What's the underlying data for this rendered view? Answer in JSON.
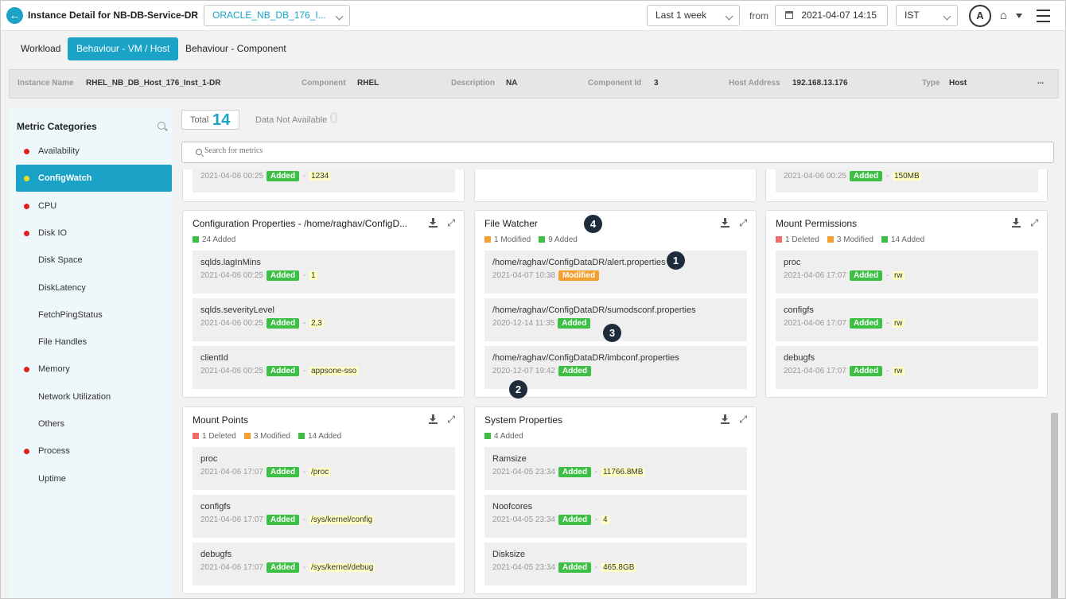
{
  "header": {
    "title": "Instance Detail for NB-DB-Service-DR",
    "instance_select": "ORACLE_NB_DB_176_I...",
    "range_select": "Last 1 week",
    "from_label": "from",
    "from_date": "2021-04-07 14:15",
    "tz_select": "IST",
    "avatar": "A"
  },
  "tabs": [
    "Workload",
    "Behaviour - VM / Host",
    "Behaviour - Component"
  ],
  "info": {
    "instance_name_label": "Instance Name",
    "instance_name": "RHEL_NB_DB_Host_176_Inst_1-DR",
    "component_label": "Component",
    "component": "RHEL",
    "description_label": "Description",
    "description": "NA",
    "component_id_label": "Component Id",
    "component_id": "3",
    "host_address_label": "Host Address",
    "host_address": "192.168.13.176",
    "type_label": "Type",
    "type": "Host",
    "more": "..."
  },
  "sidebar": {
    "title": "Metric Categories",
    "items": [
      {
        "label": "Availability",
        "status": "red"
      },
      {
        "label": "ConfigWatch",
        "status": "yellow",
        "active": true
      },
      {
        "label": "CPU",
        "status": "red"
      },
      {
        "label": "Disk IO",
        "status": "red"
      },
      {
        "label": "Disk Space",
        "status": "none"
      },
      {
        "label": "DiskLatency",
        "status": "none"
      },
      {
        "label": "FetchPingStatus",
        "status": "none"
      },
      {
        "label": "File Handles",
        "status": "none"
      },
      {
        "label": "Memory",
        "status": "red"
      },
      {
        "label": "Network Utilization",
        "status": "none"
      },
      {
        "label": "Others",
        "status": "none"
      },
      {
        "label": "Process",
        "status": "red"
      },
      {
        "label": "Uptime",
        "status": "none"
      }
    ]
  },
  "totals": {
    "total_label": "Total",
    "total": "14",
    "na_label": "Data Not Available",
    "na": "0"
  },
  "search": {
    "placeholder": "Search for metrics"
  },
  "partial_rows": [
    {
      "date": "2021-04-06 00:25",
      "badge": "Added",
      "value": "1234"
    },
    {
      "date": "2021-04-06 00:25",
      "badge": "Added",
      "value": "150MB"
    }
  ],
  "cards": [
    {
      "title": "Configuration Properties - /home/raghav/ConfigD...",
      "stats": [
        {
          "color": "g",
          "text": "24 Added"
        }
      ],
      "rows": [
        {
          "name": "sqlds.lagInMins",
          "date": "2021-04-06 00:25",
          "badge": "Added",
          "value": "1"
        },
        {
          "name": "sqlds.severityLevel",
          "date": "2021-04-06 00:25",
          "badge": "Added",
          "value": "2,3"
        },
        {
          "name": "clientId",
          "date": "2021-04-06 00:25",
          "badge": "Added",
          "value": "appsone-sso"
        }
      ]
    },
    {
      "title": "File Watcher",
      "stats": [
        {
          "color": "o",
          "text": "1 Modified"
        },
        {
          "color": "g",
          "text": "9 Added"
        }
      ],
      "rows": [
        {
          "name": "/home/raghav/ConfigDataDR/alert.properties",
          "date": "2021-04-07 10:38",
          "badge": "Modified",
          "value": ""
        },
        {
          "name": "/home/raghav/ConfigDataDR/sumodsconf.properties",
          "date": "2020-12-14 11:35",
          "badge": "Added",
          "value": ""
        },
        {
          "name": "/home/raghav/ConfigDataDR/imbconf.properties",
          "date": "2020-12-07 19:42",
          "badge": "Added",
          "value": ""
        }
      ]
    },
    {
      "title": "Mount Permissions",
      "stats": [
        {
          "color": "r",
          "text": "1 Deleted"
        },
        {
          "color": "o",
          "text": "3 Modified"
        },
        {
          "color": "g",
          "text": "14 Added"
        }
      ],
      "rows": [
        {
          "name": "proc",
          "date": "2021-04-06 17:07",
          "badge": "Added",
          "value": "rw"
        },
        {
          "name": "configfs",
          "date": "2021-04-06 17:07",
          "badge": "Added",
          "value": "rw"
        },
        {
          "name": "debugfs",
          "date": "2021-04-06 17:07",
          "badge": "Added",
          "value": "rw"
        }
      ]
    },
    {
      "title": "Mount Points",
      "stats": [
        {
          "color": "r",
          "text": "1 Deleted"
        },
        {
          "color": "o",
          "text": "3 Modified"
        },
        {
          "color": "g",
          "text": "14 Added"
        }
      ],
      "rows": [
        {
          "name": "proc",
          "date": "2021-04-06 17:07",
          "badge": "Added",
          "value": "/proc"
        },
        {
          "name": "configfs",
          "date": "2021-04-06 17:07",
          "badge": "Added",
          "value": "/sys/kernel/config"
        },
        {
          "name": "debugfs",
          "date": "2021-04-06 17:07",
          "badge": "Added",
          "value": "/sys/kernel/debug"
        }
      ]
    },
    {
      "title": "System Properties",
      "stats": [
        {
          "color": "g",
          "text": "4 Added"
        }
      ],
      "rows": [
        {
          "name": "Ramsize",
          "date": "2021-04-05 23:34",
          "badge": "Added",
          "value": "11766.8MB"
        },
        {
          "name": "Noofcores",
          "date": "2021-04-05 23:34",
          "badge": "Added",
          "value": "4"
        },
        {
          "name": "Disksize",
          "date": "2021-04-05 23:34",
          "badge": "Added",
          "value": "465.8GB"
        }
      ]
    }
  ],
  "callouts": [
    "1",
    "2",
    "3",
    "4"
  ],
  "colors": {
    "accent": "#1aa2c7",
    "added": "#3dbf45",
    "modified": "#f4a030",
    "deleted": "#f26b6b",
    "callout": "#1d2b3a"
  }
}
